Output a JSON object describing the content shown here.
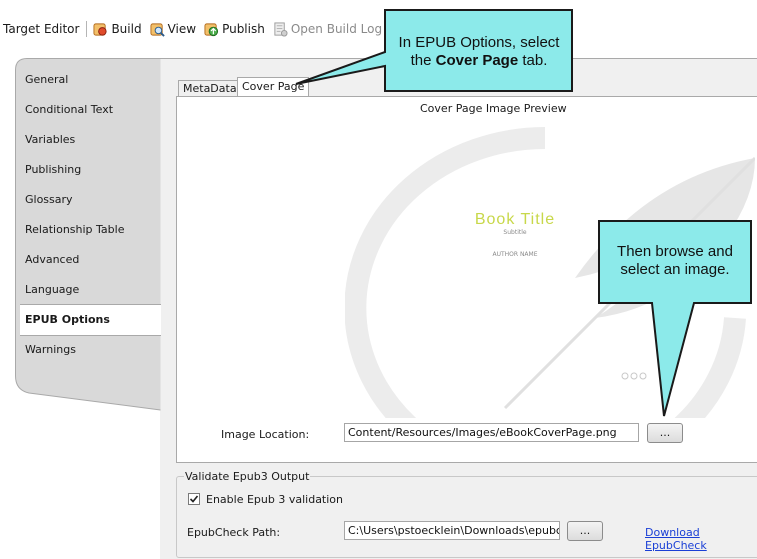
{
  "toolbar": {
    "title": "Target Editor",
    "build": "Build",
    "view": "View",
    "publish": "Publish",
    "open_build_log": "Open Build Log"
  },
  "sidebar": {
    "items": [
      {
        "label": "General"
      },
      {
        "label": "Conditional Text"
      },
      {
        "label": "Variables"
      },
      {
        "label": "Publishing"
      },
      {
        "label": "Glossary"
      },
      {
        "label": "Relationship Table"
      },
      {
        "label": "Advanced"
      },
      {
        "label": "Language"
      },
      {
        "label": "EPUB Options"
      },
      {
        "label": "Warnings"
      }
    ],
    "selected": "EPUB Options"
  },
  "tabs": [
    {
      "label": "MetaData"
    },
    {
      "label": "Cover Page"
    }
  ],
  "cover_page": {
    "preview_title": "Cover Page Image Preview",
    "book_title": "Book Title",
    "subtitle": "Subtitle",
    "author": "AUTHOR NAME",
    "image_location_label": "Image Location:",
    "image_location_value": "Content/Resources/Images/eBookCoverPage.png",
    "browse_label": "..."
  },
  "validate": {
    "group_title": "Validate Epub3 Output",
    "checkbox_label": "Enable Epub 3 validation",
    "checked": true,
    "path_label": "EpubCheck Path:",
    "path_value": "C:\\Users\\pstoecklein\\Downloads\\epubcheck",
    "browse_label": "...",
    "download_link": "Download EpubCheck"
  },
  "callouts": {
    "top_prefix": "In EPUB Options, select the",
    "top_bold": "Cover Page",
    "top_suffix": "tab.",
    "right": "Then browse and select an image."
  },
  "colors": {
    "callout_fill": "#8ceaea",
    "book_title": "#c8d84a",
    "link": "#1a3fd6"
  }
}
